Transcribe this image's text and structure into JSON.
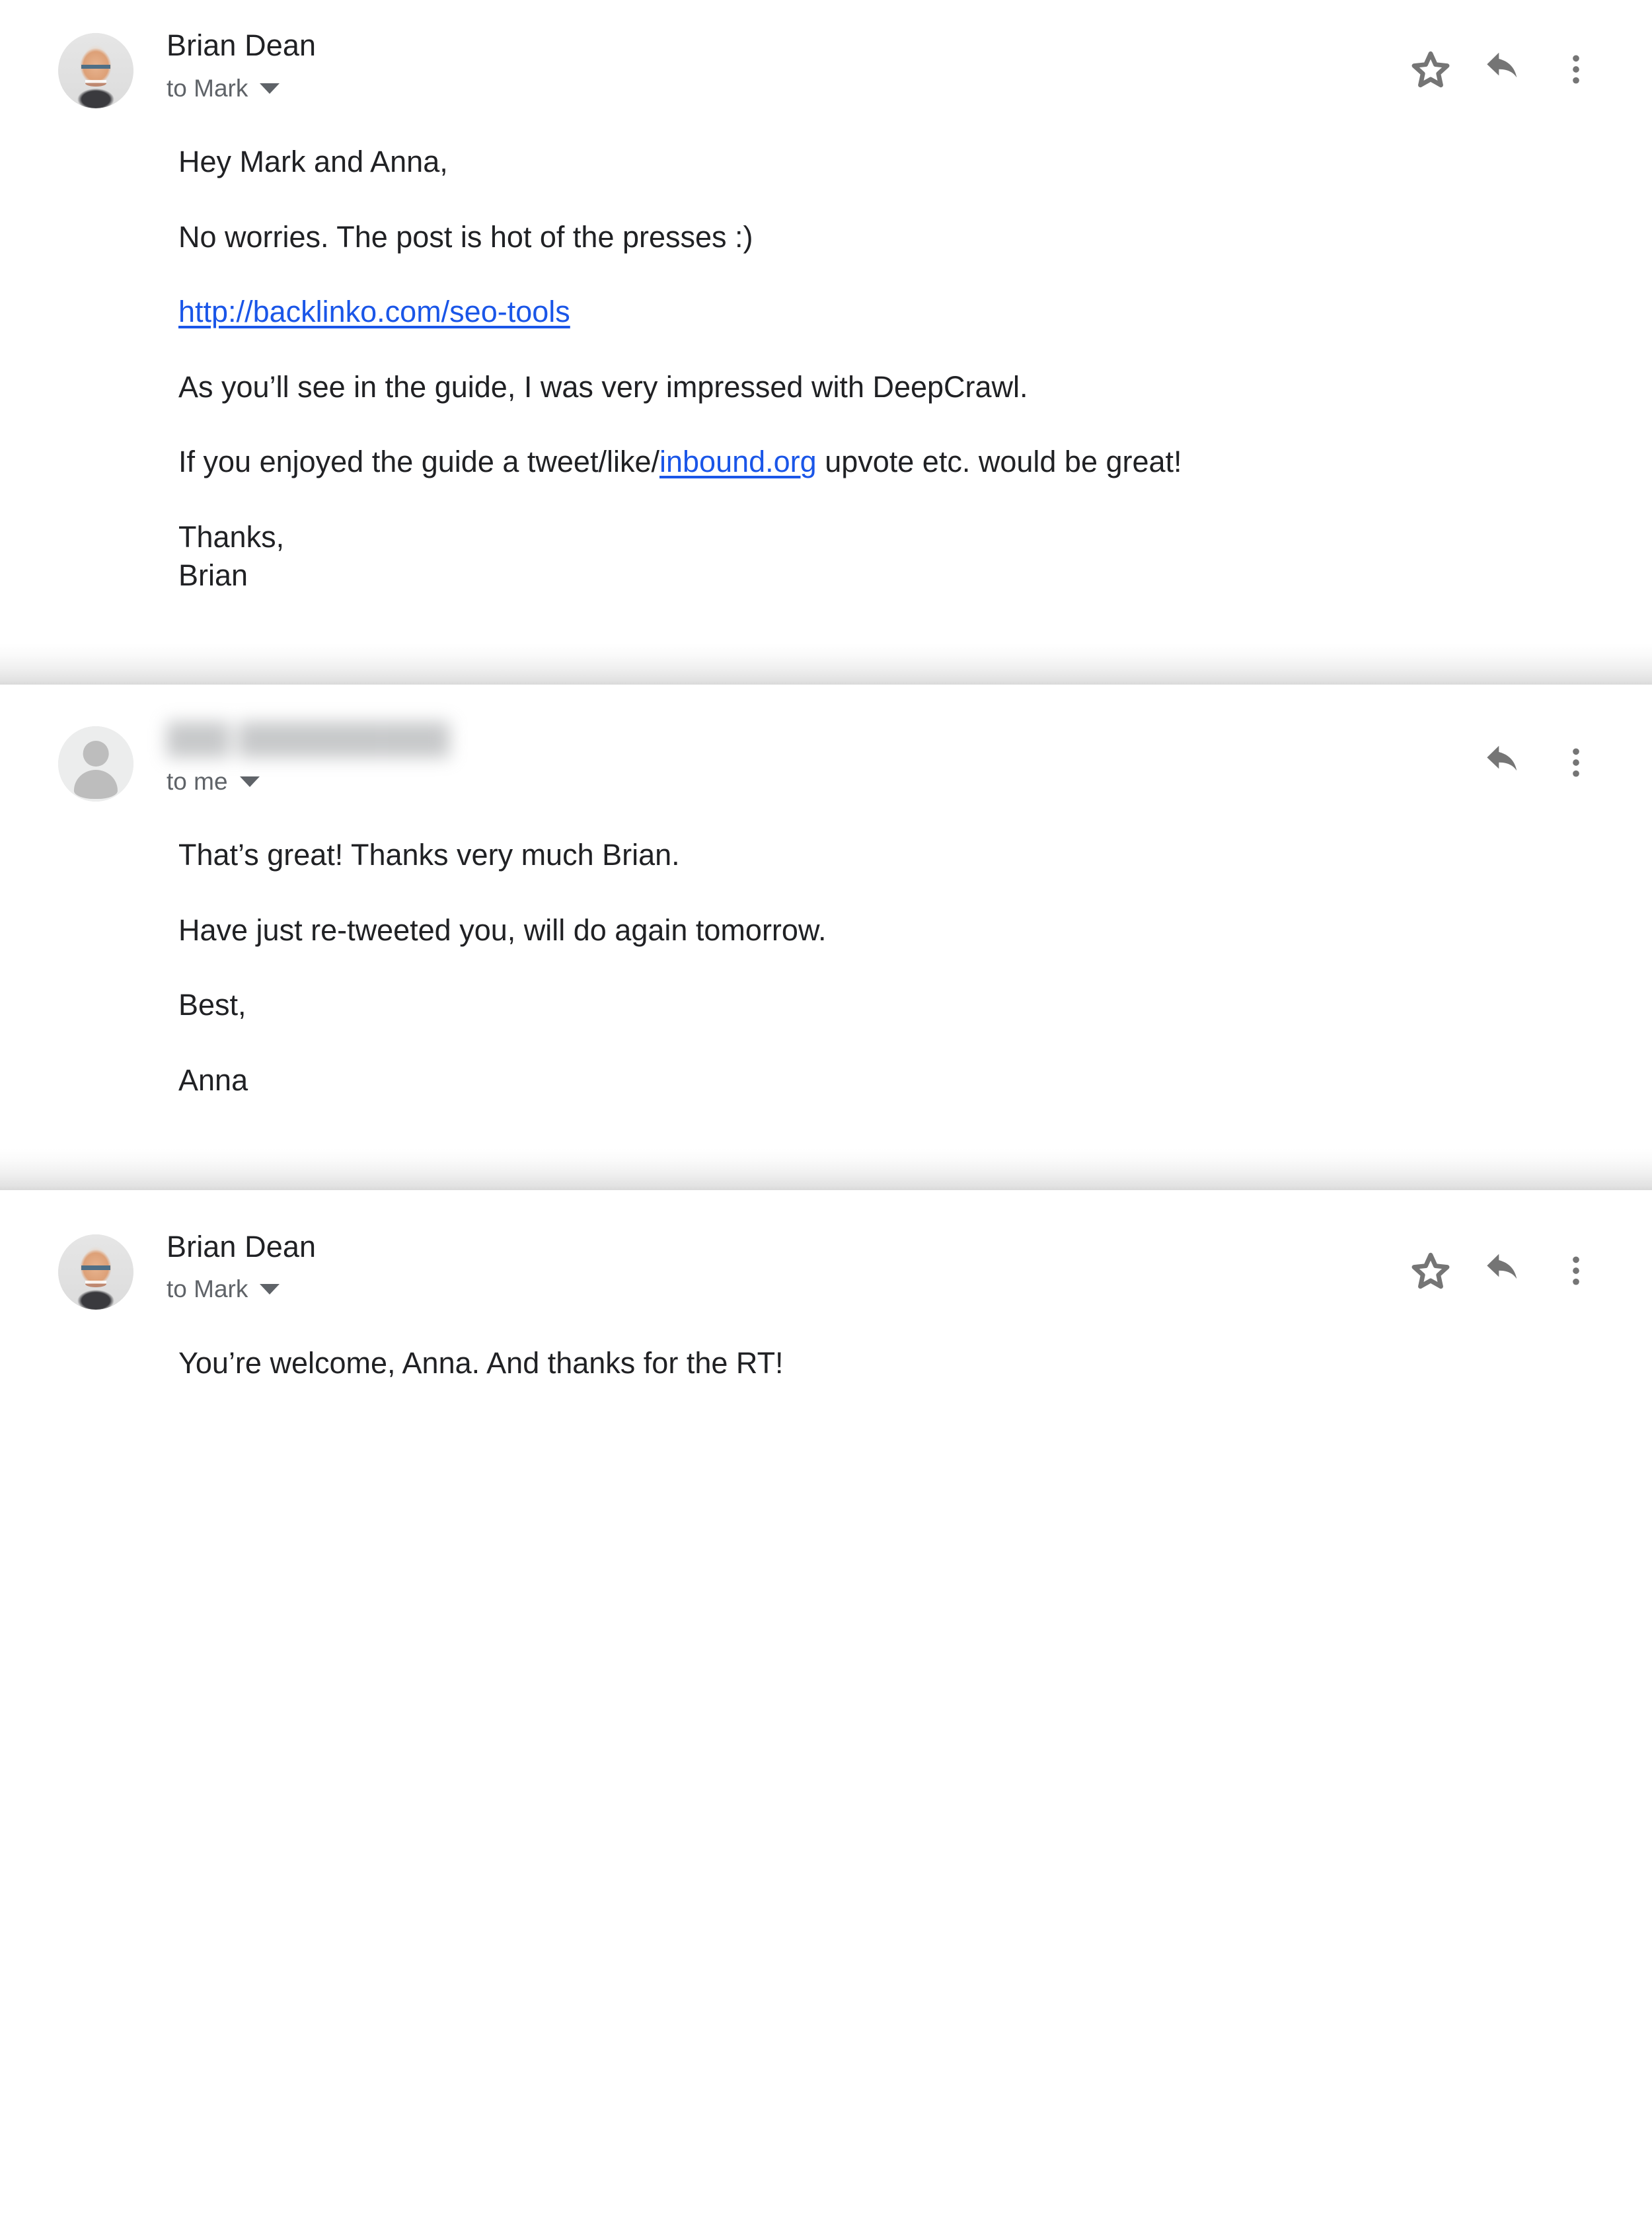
{
  "thread": {
    "messages": [
      {
        "sender": "Brian Dean",
        "sender_redacted": false,
        "recipient": "to Mark",
        "avatar_type": "photo-avatar",
        "actions": [
          "star-icon",
          "reply-icon",
          "more-vert-icon"
        ],
        "body": {
          "p1": "Hey Mark and Anna,",
          "p2": "No worries. The post is hot of the presses :)",
          "p3_link_text": "http://backlinko.com/seo-tools",
          "p4": "As you’ll see in the guide, I was very impressed with DeepCrawl.",
          "p5_before": "If you enjoyed the guide a tweet/like/",
          "p5_link_text": "inbound.org",
          "p5_after": " upvote etc. would be great!",
          "p6_line1": "Thanks,",
          "p6_line2": "Brian"
        }
      },
      {
        "sender": "███ ██████████",
        "sender_redacted": true,
        "recipient": "to me",
        "avatar_type": "generic-person-avatar",
        "actions": [
          "reply-icon",
          "more-vert-icon"
        ],
        "body": {
          "p1": "That’s great! Thanks very much Brian.",
          "p2": "Have just re-tweeted you, will do again tomorrow.",
          "p3": "Best,",
          "p4": "Anna"
        }
      },
      {
        "sender": "Brian Dean",
        "sender_redacted": false,
        "recipient": "to Mark",
        "avatar_type": "photo-avatar",
        "actions": [
          "star-icon",
          "reply-icon",
          "more-vert-icon"
        ],
        "body": {
          "p1": "You’re welcome, Anna. And thanks for the RT!"
        }
      }
    ]
  },
  "colors": {
    "link": "#1a56e8",
    "text_primary": "#202124",
    "text_secondary": "#5f6368",
    "icon": "#757575",
    "background": "#ffffff",
    "divider_shadow": "#d6d6d6"
  }
}
